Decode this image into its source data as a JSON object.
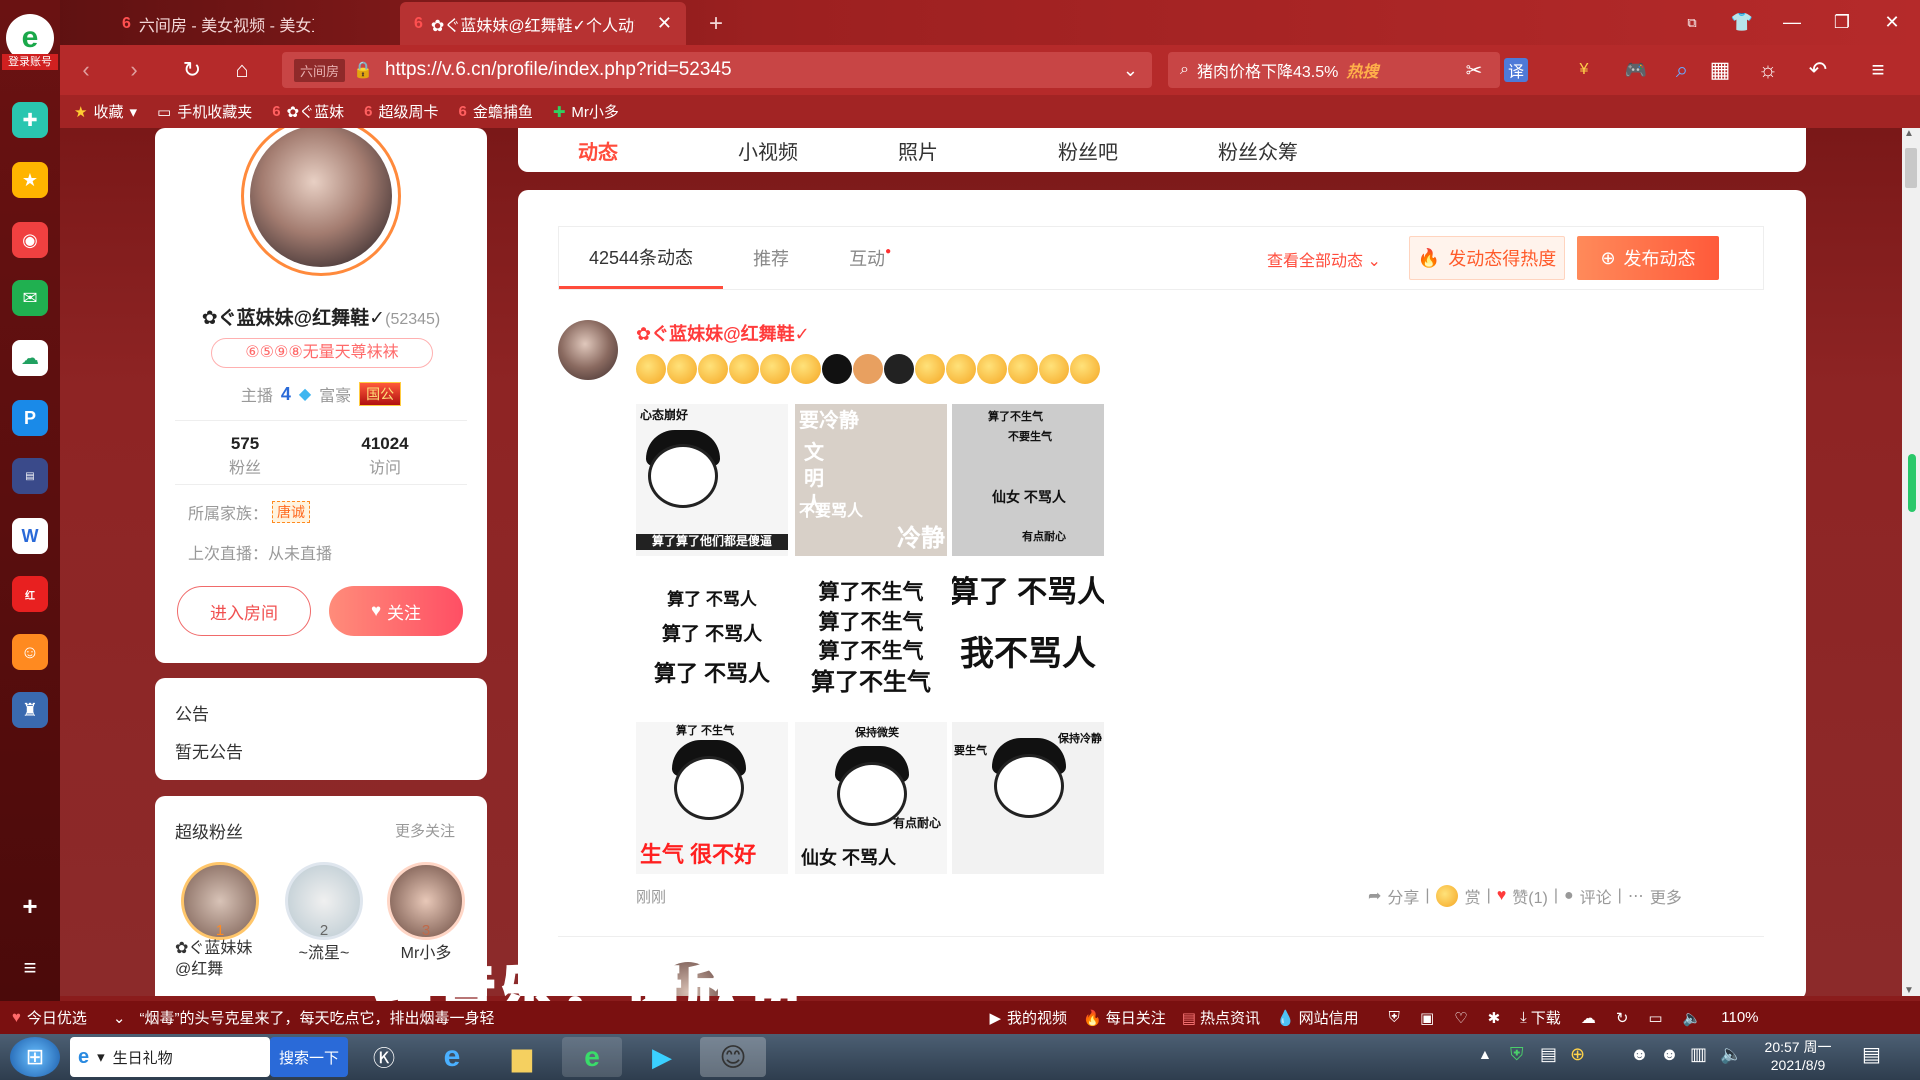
{
  "tabs": [
    {
      "label": "六间房 - 美女视频 - 美女直播"
    },
    {
      "label": "✿ぐ蓝妹妹@红舞鞋✓个人动态"
    }
  ],
  "address": {
    "url": "https://v.6.cn/profile/index.php?rid=52345",
    "site_badge": "六间房"
  },
  "search": {
    "text": "猪肉价格下降43.5%",
    "hot": "热搜"
  },
  "bookmarks": [
    "收藏",
    "手机收藏夹",
    "✿ぐ蓝妹",
    "超级周卡",
    "金蟾捕鱼",
    "Mr小多"
  ],
  "sidebar": {
    "login": "登录账号"
  },
  "topnav": [
    "动态",
    "小视频",
    "照片",
    "粉丝吧",
    "粉丝众筹"
  ],
  "profile": {
    "name": "✿ぐ蓝妹妹@红舞鞋✓",
    "rid": "(52345)",
    "title_badge": "⑥⑤⑨⑧无量天尊袜袜",
    "anchor_label": "主播",
    "anchor_level": "4",
    "rich_label": "富豪",
    "rich_badge": "国公",
    "fans_count": "575",
    "fans_label": "粉丝",
    "visits_count": "41024",
    "visits_label": "访问",
    "family_label": "所属家族：",
    "family_badge": "唐诚",
    "last_live": "上次直播：从未直播",
    "enter_btn": "进入房间",
    "follow_btn": "关注"
  },
  "notice": {
    "title": "公告",
    "content": "暂无公告"
  },
  "superfans": {
    "title": "超级粉丝",
    "more": "更多关注",
    "fans": [
      {
        "rank": "1",
        "name": "✿ぐ蓝妹妹@红舞"
      },
      {
        "rank": "2",
        "name": "~流星~"
      },
      {
        "rank": "3",
        "name": "Mr小多"
      }
    ]
  },
  "feed": {
    "tabs": [
      "42544条动态",
      "推荐",
      "互动"
    ],
    "view_all": "查看全部动态",
    "hot_btn": "发动态得热度",
    "post_btn": "发布动态",
    "post": {
      "author": "✿ぐ蓝妹妹@红舞鞋✓",
      "time": "刚刚",
      "actions": {
        "share": "分享",
        "reward": "赏",
        "like": "赞(1)",
        "comment": "评论",
        "more": "更多"
      }
    }
  },
  "memes": [
    [
      "心态崩好",
      "算了算了他们都是傻逼"
    ],
    [
      "要冷静",
      "文明人",
      "不要骂人",
      "冷静"
    ],
    [
      "算了不生气",
      "不要生气",
      "仙女 不骂人",
      "有点耐心"
    ],
    [
      "算了 不骂人",
      "算了 不骂人",
      "算了 不骂人"
    ],
    [
      "算了不生气",
      "算了不生气",
      "算了不生气",
      "算了不生气"
    ],
    [
      "算了 不骂人",
      "我不骂人"
    ],
    [
      "算了 不生气",
      "生气 很不好"
    ],
    [
      "保持微笑",
      "有点耐心",
      "仙女 不骂人"
    ],
    [
      "要生气",
      "保持冷静"
    ]
  ],
  "subtitle": "纯音乐，请欣赏",
  "statusbar": {
    "left": "今日优选",
    "news": "“烟毒”的头号克星来了，每天吃点它，排出烟毒一身轻",
    "items": [
      "我的视频",
      "每日关注",
      "热点资讯",
      "网站信用"
    ],
    "download": "下载",
    "zoom": "110%"
  },
  "taskbar": {
    "task_label": "生日礼物",
    "search_btn": "搜索一下",
    "time": "20:57 周一",
    "date": "2021/8/9"
  }
}
